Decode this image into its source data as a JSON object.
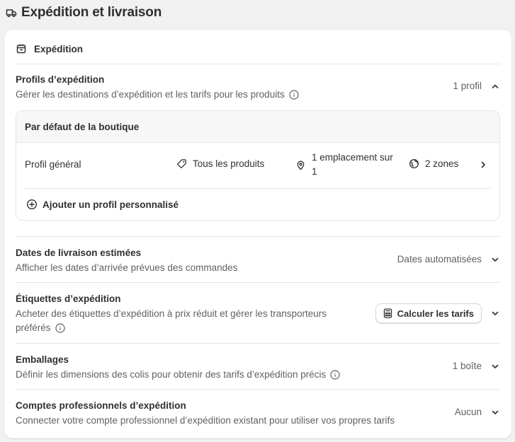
{
  "page": {
    "title": "Expédition et livraison"
  },
  "card": {
    "header_label": "Expédition"
  },
  "profiles": {
    "title": "Profils d’expédition",
    "description": "Gérer les destinations d’expédition et les tarifs pour les produits",
    "count_label": "1 profil",
    "group_title": "Par défaut de la boutique",
    "general": {
      "name": "Profil général",
      "products": "Tous les produits",
      "locations_line1": "1 emplacement sur",
      "locations_line2": "1",
      "zones": "2 zones"
    },
    "add_label": "Ajouter un profil personnalisé"
  },
  "delivery_dates": {
    "title": "Dates de livraison estimées",
    "description": "Afficher les dates d’arrivée prévues des commandes",
    "value": "Dates automatisées"
  },
  "labels": {
    "title": "Étiquettes d’expédition",
    "description_line1": "Acheter des étiquettes d’expédition à prix réduit et gérer les transporteurs",
    "description_line2": "préférés",
    "button_label": "Calculer les tarifs"
  },
  "packaging": {
    "title": "Emballages",
    "description": "Définir les dimensions des colis pour obtenir des tarifs d’expédition précis",
    "value": "1 boîte"
  },
  "pro_accounts": {
    "title": "Comptes professionnels d’expédition",
    "description": "Connecter votre compte professionnel d’expédition existant pour utiliser vos propres tarifs",
    "value": "Aucun"
  }
}
